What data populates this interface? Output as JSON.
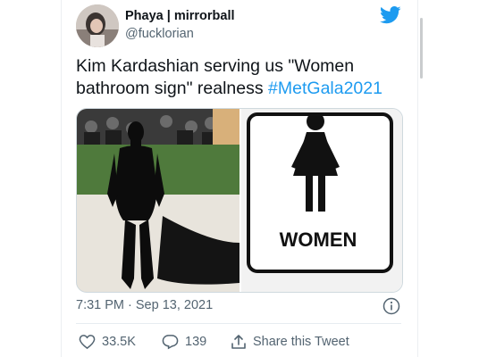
{
  "tweet": {
    "author_name": "Phaya | mirrorball",
    "handle": "@fucklorian",
    "text": "Kim Kardashian serving us \"Women bathroom sign\" realness ",
    "hashtag": "#MetGala2021",
    "timestamp": "7:31 PM · Sep 13, 2021"
  },
  "media": {
    "sign_text": "WOMEN"
  },
  "actions": {
    "likes_count": "33.5K",
    "replies_count": "139",
    "share_label": "Share this Tweet"
  },
  "icons": {
    "brand": "twitter-bird-icon",
    "info": "info-icon",
    "like": "heart-icon",
    "reply": "reply-bubble-icon",
    "share": "share-icon"
  },
  "colors": {
    "brand_blue": "#1d9bf0",
    "text_primary": "#0f1419",
    "text_secondary": "#536471"
  }
}
